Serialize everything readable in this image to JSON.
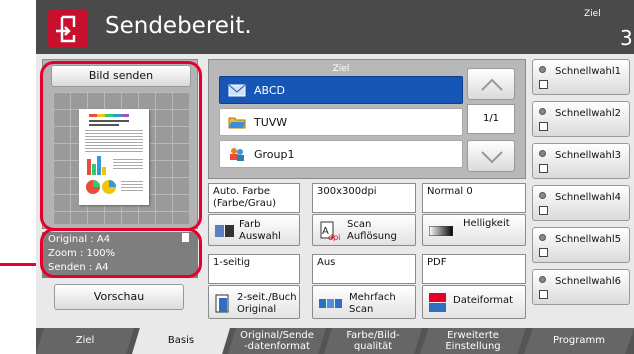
{
  "header": {
    "title": "Sendebereit.",
    "ziel_label": "Ziel",
    "ziel_count": "3"
  },
  "preview": {
    "title": "Bild senden",
    "info": {
      "original": "Original  : A4",
      "zoom": "Zoom      : 100%",
      "senden": "Senden    : A4"
    },
    "vorschau": "Vorschau"
  },
  "destinations": {
    "header": "Ziel",
    "items": [
      {
        "label": "ABCD",
        "selected": true
      },
      {
        "label": "TUVW",
        "selected": false
      },
      {
        "label": "Group1",
        "selected": false
      }
    ],
    "page_indicator": "1/1"
  },
  "functions": {
    "farbe_value": "Auto. Farbe\n(Farbe/Grau)",
    "aufloesung_value": "300x300dpi",
    "helligkeit_value": "Normal 0",
    "farb_auswahl": "Farb\nAuswahl",
    "scan_aufloesung": "Scan\nAuflösung",
    "helligkeit": "Helligkeit",
    "seitig_value": "1-seitig",
    "mehrfach_value": "Aus",
    "dateiformat_value": "PDF",
    "seit_buch": "2-seit./Buch\nOriginal",
    "mehrfach_scan": "Mehrfach\nScan",
    "dateiformat": "Dateiformat"
  },
  "quick_dials": [
    "Schnellwahl1",
    "Schnellwahl2",
    "Schnellwahl3",
    "Schnellwahl4",
    "Schnellwahl5",
    "Schnellwahl6"
  ],
  "tabs": [
    {
      "label": "Ziel",
      "active": false
    },
    {
      "label": "Basis",
      "active": true
    },
    {
      "label": "Original/Sende\n-datenformat",
      "active": false
    },
    {
      "label": "Farbe/Bild-\nqualität",
      "active": false
    },
    {
      "label": "Erweiterte\nEinstellung",
      "active": false
    },
    {
      "label": "Programm",
      "active": false
    }
  ],
  "colors": {
    "accent_red": "#e3002b",
    "selected_blue": "#1556b7",
    "topbar": "#4a4a4a"
  }
}
